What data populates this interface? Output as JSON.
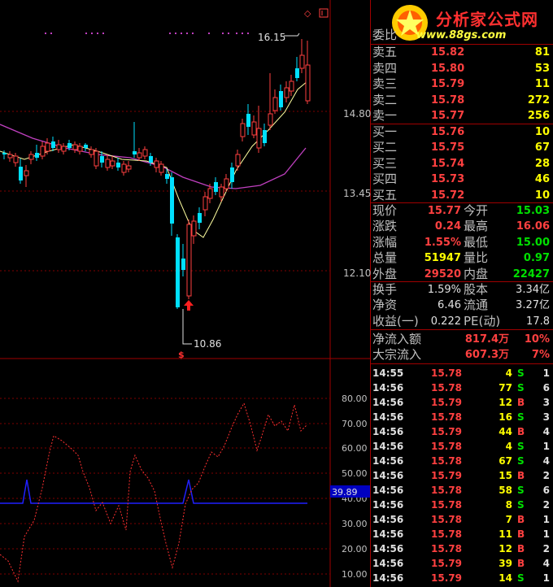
{
  "logo": {
    "title": "分析家公式网",
    "url": "www.88gs.com"
  },
  "main_chart": {
    "price_labels": [
      "14.80",
      "13.45",
      "12.10"
    ],
    "high_marker": "16.15",
    "low_marker": "10.86",
    "signal_glyph": "$"
  },
  "indicator": {
    "axis_labels": [
      "80.00",
      "70.00",
      "60.00",
      "50.00",
      "40.00",
      "30.00",
      "20.00",
      "10.00"
    ],
    "current_value": "39.89"
  },
  "order_book": {
    "header": "委比",
    "asks": [
      {
        "label": "卖五",
        "price": "15.82",
        "volume": "81"
      },
      {
        "label": "卖四",
        "price": "15.80",
        "volume": "53"
      },
      {
        "label": "卖三",
        "price": "15.79",
        "volume": "11"
      },
      {
        "label": "卖二",
        "price": "15.78",
        "volume": "272"
      },
      {
        "label": "卖一",
        "price": "15.77",
        "volume": "256"
      }
    ],
    "bids": [
      {
        "label": "买一",
        "price": "15.76",
        "volume": "10"
      },
      {
        "label": "买二",
        "price": "15.75",
        "volume": "67"
      },
      {
        "label": "买三",
        "price": "15.74",
        "volume": "28"
      },
      {
        "label": "买四",
        "price": "15.73",
        "volume": "46"
      },
      {
        "label": "买五",
        "price": "15.72",
        "volume": "10"
      }
    ]
  },
  "quote": [
    {
      "l1": "现价",
      "v1": "15.77",
      "c1": "red",
      "l2": "今开",
      "v2": "15.03",
      "c2": "grn"
    },
    {
      "l1": "涨跌",
      "v1": "0.24",
      "c1": "red",
      "l2": "最高",
      "v2": "16.06",
      "c2": "red"
    },
    {
      "l1": "涨幅",
      "v1": "1.55%",
      "c1": "red",
      "l2": "最低",
      "v2": "15.00",
      "c2": "grn"
    },
    {
      "l1": "总量",
      "v1": "51947",
      "c1": "yel",
      "l2": "量比",
      "v2": "0.97",
      "c2": "grn"
    },
    {
      "l1": "外盘",
      "v1": "29520",
      "c1": "red",
      "l2": "内盘",
      "v2": "22427",
      "c2": "grn"
    }
  ],
  "fundamentals": [
    {
      "l1": "换手",
      "v1": "1.59%",
      "l2": "股本",
      "v2": "3.34亿"
    },
    {
      "l1": "净资",
      "v1": "6.46",
      "l2": "流通",
      "v2": "3.27亿"
    },
    {
      "l1": "收益(一)",
      "v1": "0.222",
      "l2": "PE(动)",
      "v2": "17.8"
    }
  ],
  "flows": [
    {
      "label": "净流入额",
      "value": "817.4万",
      "pct": "10%"
    },
    {
      "label": "大宗流入",
      "value": "607.3万",
      "pct": "7%"
    }
  ],
  "ticks": [
    {
      "time": "14:55",
      "price": "15.78",
      "vol": "4",
      "side": "S",
      "n": "1"
    },
    {
      "time": "14:56",
      "price": "15.78",
      "vol": "77",
      "side": "S",
      "n": "6"
    },
    {
      "time": "14:56",
      "price": "15.79",
      "vol": "12",
      "side": "B",
      "n": "3"
    },
    {
      "time": "14:56",
      "price": "15.78",
      "vol": "16",
      "side": "S",
      "n": "3"
    },
    {
      "time": "14:56",
      "price": "15.79",
      "vol": "44",
      "side": "B",
      "n": "4"
    },
    {
      "time": "14:56",
      "price": "15.78",
      "vol": "4",
      "side": "S",
      "n": "1"
    },
    {
      "time": "14:56",
      "price": "15.78",
      "vol": "67",
      "side": "S",
      "n": "4"
    },
    {
      "time": "14:56",
      "price": "15.79",
      "vol": "15",
      "side": "B",
      "n": "2"
    },
    {
      "time": "14:56",
      "price": "15.78",
      "vol": "58",
      "side": "S",
      "n": "6"
    },
    {
      "time": "14:56",
      "price": "15.78",
      "vol": "8",
      "side": "S",
      "n": "2"
    },
    {
      "time": "14:56",
      "price": "15.78",
      "vol": "7",
      "side": "B",
      "n": "1"
    },
    {
      "time": "14:56",
      "price": "15.78",
      "vol": "11",
      "side": "B",
      "n": "1"
    },
    {
      "time": "14:56",
      "price": "15.78",
      "vol": "12",
      "side": "B",
      "n": "2"
    },
    {
      "time": "14:56",
      "price": "15.79",
      "vol": "39",
      "side": "B",
      "n": "4"
    },
    {
      "time": "14:56",
      "price": "15.79",
      "vol": "14",
      "side": "S",
      "n": "1"
    }
  ],
  "colors": {
    "up": "#ff4040",
    "down": "#00e0ff",
    "ma_short": "#ffffa0",
    "ma_long": "#c040c0",
    "grid": "#800000"
  }
}
